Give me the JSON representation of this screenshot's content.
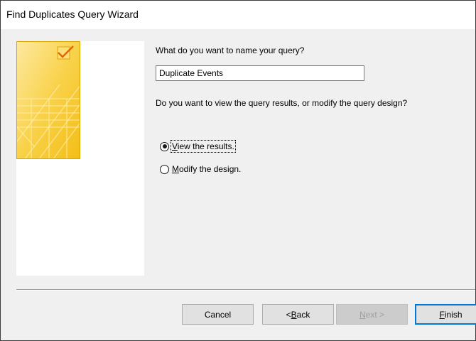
{
  "window": {
    "title": "Find Duplicates Query Wizard"
  },
  "prompt_name": "What do you want to name your query?",
  "query_name": "Duplicate Events",
  "prompt_view": "Do you want to view the query results, or modify the query design?",
  "options": [
    {
      "accel": "V",
      "rest": "iew the results.",
      "selected": true
    },
    {
      "accel": "M",
      "rest": "odify the design.",
      "selected": false
    }
  ],
  "buttons": {
    "cancel": "Cancel",
    "back": {
      "prefix": "< ",
      "accel": "B",
      "rest": "ack"
    },
    "next": {
      "accel": "N",
      "rest": "ext >",
      "disabled": true
    },
    "finish": {
      "accel": "F",
      "rest": "inish"
    }
  },
  "icons": {
    "wizard_graphic": "wizard-graphic-icon",
    "checkbox": "checkmark-icon"
  },
  "colors": {
    "graphic_yellow": "#f7c928",
    "graphic_light": "#fde58a",
    "focus_blue": "#0078d7"
  }
}
